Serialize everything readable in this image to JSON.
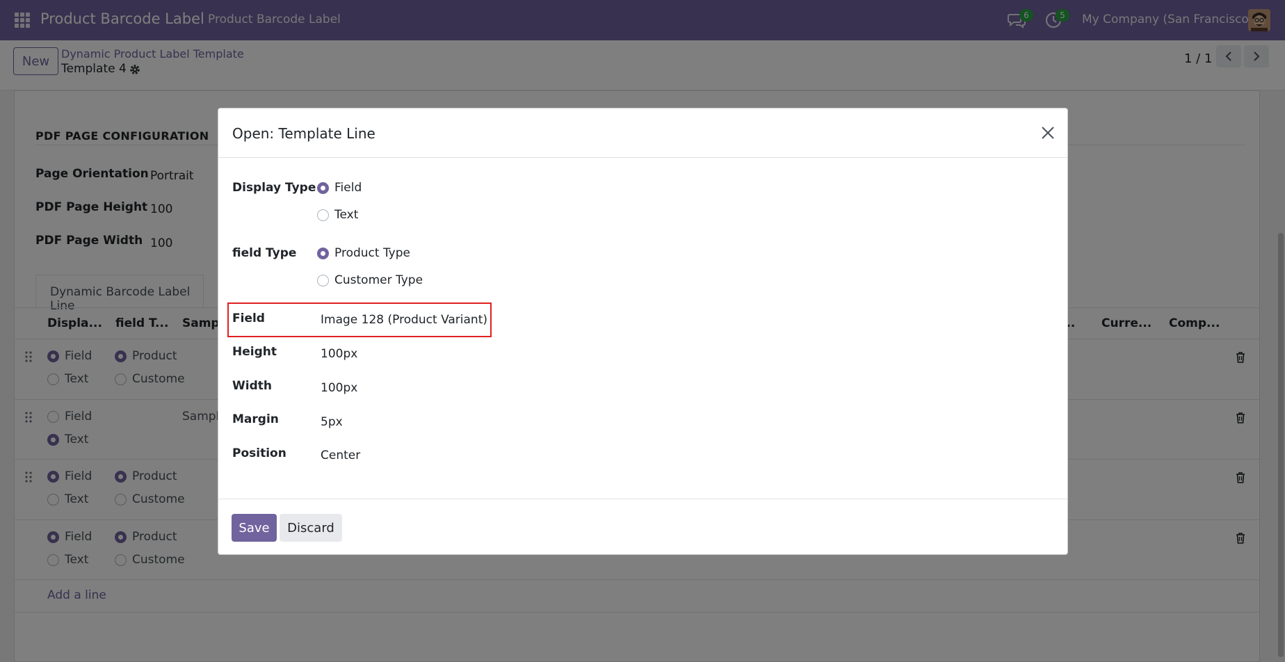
{
  "navbar": {
    "app_title": "Product Barcode Label",
    "menu_item": "Product Barcode Label",
    "messages_count": "6",
    "activities_count": "5",
    "company": "My Company (San Francisco)"
  },
  "control_panel": {
    "new_label": "New",
    "breadcrumb_parent": "Dynamic Product Label Template",
    "breadcrumb_current": "Template 4",
    "pager": "1 / 1"
  },
  "form": {
    "section_title": "PDF PAGE CONFIGURATION",
    "fields": [
      {
        "label": "Page Orientation",
        "value": "Portrait"
      },
      {
        "label": "PDF Page Height",
        "value": "100"
      },
      {
        "label": "PDF Page Width",
        "value": "100"
      }
    ],
    "tab_label": "Dynamic Barcode Label Line",
    "columns": [
      "Displa...",
      "field T...",
      "Sampl",
      "...",
      "Curre...",
      "Comp..."
    ],
    "rows": [
      {
        "display_field": "Field",
        "display_text": "Text",
        "type_product": "Product",
        "type_customer": "Custome"
      },
      {
        "display_field": "Field",
        "display_text": "Text",
        "sample": "Sampl"
      },
      {
        "display_field": "Field",
        "display_text": "Text",
        "type_product": "Product",
        "type_customer": "Custome"
      },
      {
        "display_field": "Field",
        "display_text": "Text",
        "type_product": "Product",
        "type_customer": "Custome"
      }
    ],
    "add_line": "Add a line"
  },
  "modal": {
    "title": "Open: Template Line",
    "display_type": {
      "label": "Display Type",
      "options": [
        "Field",
        "Text"
      ],
      "selected": "Field"
    },
    "field_type": {
      "label": "field Type",
      "options": [
        "Product Type",
        "Customer Type"
      ],
      "selected": "Product Type"
    },
    "field": {
      "label": "Field",
      "value": "Image 128 (Product Variant)"
    },
    "height": {
      "label": "Height",
      "value": "100px"
    },
    "width": {
      "label": "Width",
      "value": "100px"
    },
    "margin": {
      "label": "Margin",
      "value": "5px"
    },
    "position": {
      "label": "Position",
      "value": "Center"
    },
    "save_label": "Save",
    "discard_label": "Discard"
  },
  "colors": {
    "brand": "#71639e",
    "highlight": "#e02020",
    "badge": "#28a745"
  }
}
